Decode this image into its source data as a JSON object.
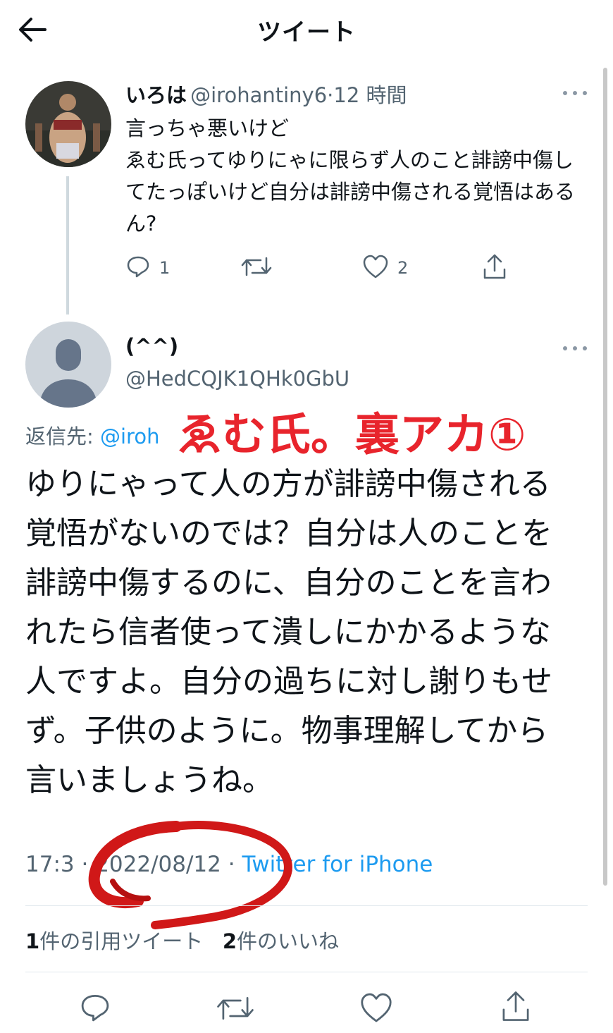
{
  "header": {
    "title": "ツイート"
  },
  "parent_tweet": {
    "display_name": "いろは",
    "handle": "@irohantiny6",
    "separator": "·",
    "time": "12 時間",
    "text": "言っちゃ悪いけど\nゑむ氏ってゆりにゃに限らず人のこと誹謗中傷してたっぽいけど自分は誹謗中傷される覚悟はあるん?",
    "reply_count": "1",
    "like_count": "2"
  },
  "main_tweet": {
    "display_name": "(^^)",
    "handle": "@HedCQJK1QHk0GbU",
    "reply_to_label": "返信先: ",
    "reply_to_handle": "@iroh",
    "text": "ゆりにゃって人の方が誹謗中傷される覚悟がないのでは？自分は人のことを誹謗中傷するのに、自分のことを言われたら信者使って潰しにかかるような人ですよ。自分の過ちに対し謝りもせず。子供のように。物事理解してから言いましょうね。",
    "time": "17:3",
    "date": "2022/08/12",
    "source": "Twitter for iPhone",
    "quote_count": "1",
    "quote_label": "件の引用ツイート",
    "like_count": "2",
    "like_label": "件のいいね"
  },
  "annotation": {
    "text": "ゑむ氏。裏アカ①",
    "color": "#e8242c"
  },
  "icons": [
    "back-arrow-icon",
    "more-icon",
    "reply-icon",
    "retweet-icon",
    "like-icon",
    "share-icon",
    "avatar-placeholder-icon"
  ],
  "colors": {
    "text": "#0f1419",
    "secondary": "#536471",
    "link": "#1d9bf0",
    "annotation_red": "#e8242c"
  }
}
